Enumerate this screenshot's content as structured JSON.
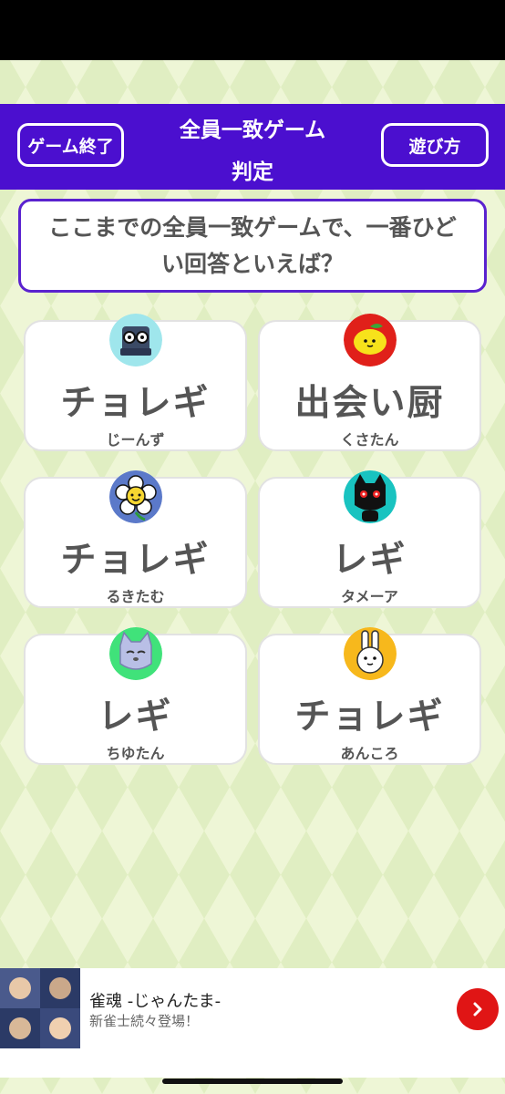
{
  "header": {
    "end_game_label": "ゲーム終了",
    "how_to_play_label": "遊び方",
    "title_line1": "全員一致ゲーム",
    "title_line2": "判定"
  },
  "question": "ここまでの全員一致ゲームで、一番ひどい回答といえば？",
  "answers": [
    {
      "answer": "チョレギ",
      "player": "じーんず",
      "avatar": "book-character-icon"
    },
    {
      "answer": "出会い厨",
      "player": "くさたん",
      "avatar": "lemon-character-icon"
    },
    {
      "answer": "チョレギ",
      "player": "るきたむ",
      "avatar": "flower-character-icon"
    },
    {
      "answer": "レギ",
      "player": "タメーア",
      "avatar": "black-cat-character-icon"
    },
    {
      "answer": "レギ",
      "player": "ちゆたん",
      "avatar": "gray-cat-character-icon"
    },
    {
      "answer": "チョレギ",
      "player": "あんころ",
      "avatar": "rabbit-character-icon"
    }
  ],
  "ad": {
    "title": "雀魂 -じゃんたま-",
    "subtitle": "新雀士続々登場！",
    "arrow_icon": "chevron-right-icon"
  },
  "colors": {
    "header": "#4b0fcf",
    "background": "#eef6d6",
    "ad_button": "#e01515"
  }
}
